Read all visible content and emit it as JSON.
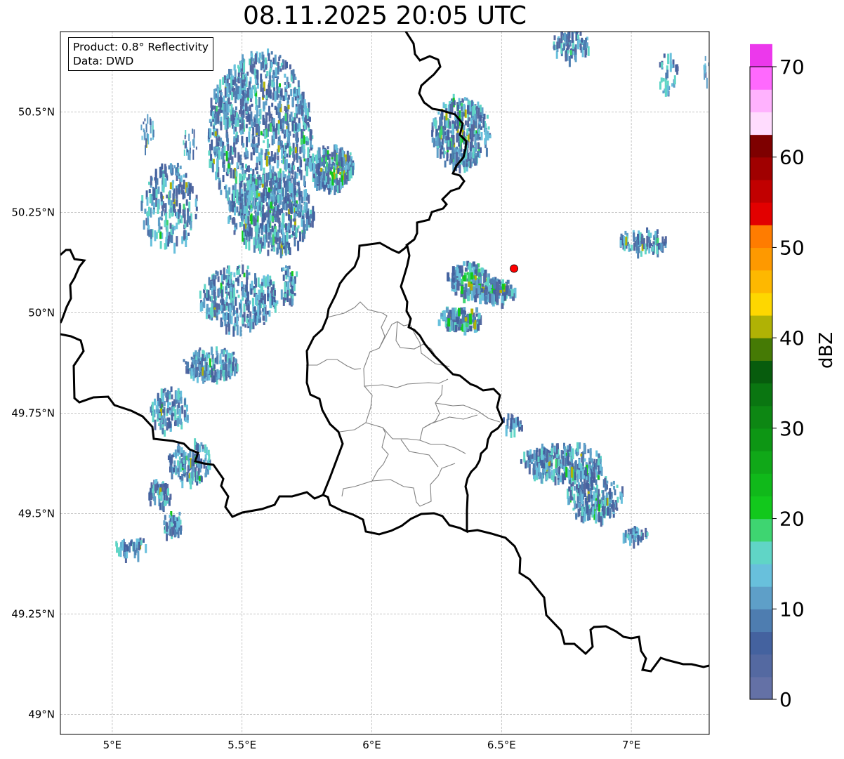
{
  "title": "08.11.2025 20:05 UTC",
  "info": {
    "product": "Product: 0.8° Reflectivity",
    "data": "Data: DWD"
  },
  "map": {
    "lon_range": [
      4.8,
      7.3
    ],
    "lat_range": [
      48.95,
      50.7
    ],
    "lon_ticks": [
      {
        "v": 5.0,
        "label": "5°E"
      },
      {
        "v": 5.5,
        "label": "5.5°E"
      },
      {
        "v": 6.0,
        "label": "6°E"
      },
      {
        "v": 6.5,
        "label": "6.5°E"
      },
      {
        "v": 7.0,
        "label": "7°E"
      }
    ],
    "lat_ticks": [
      {
        "v": 49.0,
        "label": "49°N"
      },
      {
        "v": 49.25,
        "label": "49.25°N"
      },
      {
        "v": 49.5,
        "label": "49.5°N"
      },
      {
        "v": 49.75,
        "label": "49.75°N"
      },
      {
        "v": 50.0,
        "label": "50°N"
      },
      {
        "v": 50.25,
        "label": "50.25°N"
      },
      {
        "v": 50.5,
        "label": "50.5°N"
      }
    ],
    "grid": true,
    "radar_site": {
      "lon": 6.548,
      "lat": 50.11,
      "color": "#ff0000"
    }
  },
  "colorbar": {
    "label": "dBZ",
    "min": 0,
    "max": 70,
    "step": 2.5,
    "ticks": [
      0,
      10,
      20,
      30,
      40,
      50,
      60,
      70
    ],
    "colors": [
      "#6471a6",
      "#5469a1",
      "#44629f",
      "#4e7db0",
      "#5e9fc8",
      "#68c0dc",
      "#60d5c6",
      "#3ed571",
      "#12c81c",
      "#10b91a",
      "#10a818",
      "#0d9614",
      "#0d8713",
      "#0a7611",
      "#075c0d",
      "#457a05",
      "#b0b205",
      "#fed700",
      "#feb800",
      "#fe9900",
      "#ff7c00",
      "#e20000",
      "#c10000",
      "#a00000",
      "#7e0000",
      "#ffdcfe",
      "#ffb2fe",
      "#ff69fe",
      "#ec38ec"
    ]
  },
  "echo_palette": {
    "light": [
      "#5469a1",
      "#44629f",
      "#4e7db0",
      "#5e9fc8"
    ],
    "medium": [
      "#68c0dc",
      "#60d5c6"
    ],
    "strong": [
      "#3ed571",
      "#12c81c",
      "#b0b205"
    ]
  }
}
